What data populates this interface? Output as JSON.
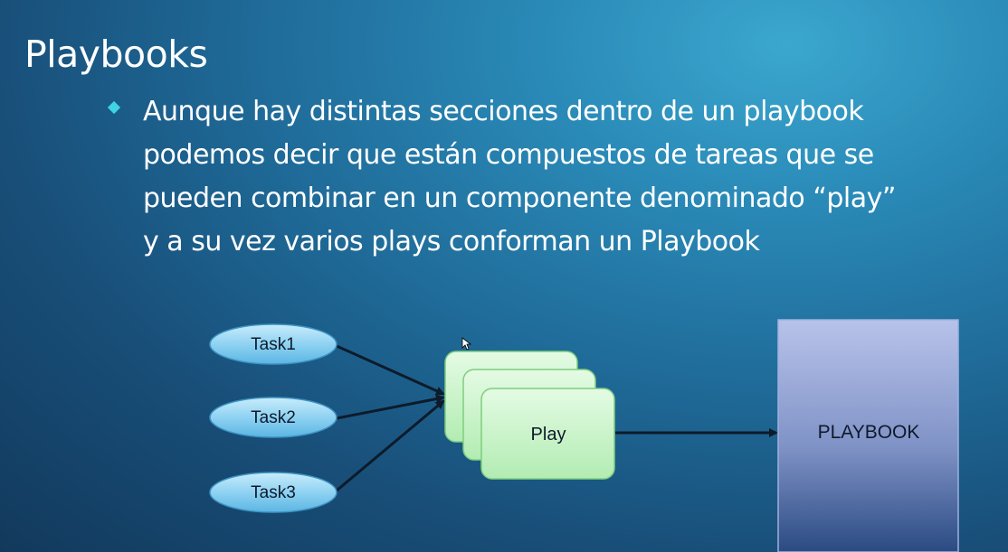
{
  "slide": {
    "title": "Playbooks",
    "bullet_lines": [
      "Aunque hay distintas secciones dentro de un playbook",
      "podemos decir que están compuestos de tareas que se",
      "pueden combinar en un componente denominado “play”",
      "y a su vez varios plays conforman un Playbook"
    ]
  },
  "diagram": {
    "tasks": [
      "Task1",
      "Task2",
      "Task3"
    ],
    "play_label": "Play",
    "playbook_label": "PLAYBOOK"
  },
  "colors": {
    "task_fill": "#8fd2f2",
    "play_fill": "#c9f5c9",
    "playbook_fill_top": "#b3bfe6",
    "playbook_fill_bottom": "#2c4f85",
    "arrow": "#0d1b2a",
    "bullet": "#3fd3e6"
  }
}
